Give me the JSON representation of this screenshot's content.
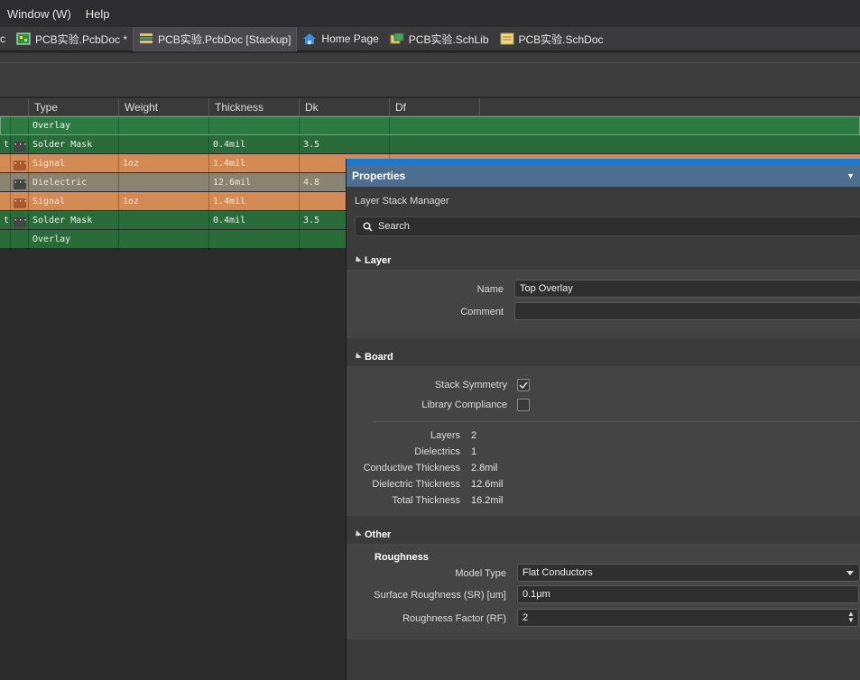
{
  "menu": {
    "window": "Window (W)",
    "help": "Help"
  },
  "tabs": [
    {
      "label": "PCB实验.PcbDoc *",
      "icon": "pcb-doc-icon",
      "active": false
    },
    {
      "label": "PCB实验.PcbDoc [Stackup]",
      "icon": "stackup-icon",
      "active": true
    },
    {
      "label": "Home Page",
      "icon": "home-icon",
      "active": false
    },
    {
      "label": "PCB实验.SchLib",
      "icon": "schlib-icon",
      "active": false
    },
    {
      "label": "PCB实验.SchDoc",
      "icon": "schdoc-icon",
      "active": false
    }
  ],
  "grid": {
    "headers": {
      "type": "Type",
      "weight": "Weight",
      "thickness": "Thickness",
      "dk": "Dk",
      "df": "Df"
    },
    "rows": [
      {
        "prefix": "",
        "type": "Overlay",
        "weight": "",
        "thickness": "",
        "dk": "",
        "style": "green-hl"
      },
      {
        "prefix": "t",
        "type": "Solder Mask",
        "weight": "",
        "thickness": "0.4mil",
        "dk": "3.5",
        "style": "green"
      },
      {
        "prefix": "",
        "type": "Signal",
        "weight": "1oz",
        "thickness": "1.4mil",
        "dk": "",
        "style": "orange"
      },
      {
        "prefix": "",
        "type": "Dielectric",
        "weight": "",
        "thickness": "12.6mil",
        "dk": "4.8",
        "style": "gray"
      },
      {
        "prefix": "",
        "type": "Signal",
        "weight": "1oz",
        "thickness": "1.4mil",
        "dk": "",
        "style": "orange"
      },
      {
        "prefix": "t",
        "type": "Solder Mask",
        "weight": "",
        "thickness": "0.4mil",
        "dk": "3.5",
        "style": "green"
      },
      {
        "prefix": "",
        "type": "Overlay",
        "weight": "",
        "thickness": "",
        "dk": "",
        "style": "green"
      }
    ]
  },
  "properties": {
    "title": "Properties",
    "subtitle": "Layer Stack Manager",
    "search_placeholder": "Search",
    "layer": {
      "header": "Layer",
      "name_label": "Name",
      "name_value": "Top Overlay",
      "comment_label": "Comment",
      "comment_value": ""
    },
    "board": {
      "header": "Board",
      "stack_symmetry_label": "Stack Symmetry",
      "stack_symmetry_checked": true,
      "library_compliance_label": "Library Compliance",
      "library_compliance_checked": false,
      "stats": [
        {
          "label": "Layers",
          "value": "2"
        },
        {
          "label": "Dielectrics",
          "value": "1"
        },
        {
          "label": "Conductive Thickness",
          "value": "2.8mil"
        },
        {
          "label": "Dielectric Thickness",
          "value": "12.6mil"
        },
        {
          "label": "Total Thickness",
          "value": "16.2mil"
        }
      ]
    },
    "other": {
      "header": "Other",
      "roughness_header": "Roughness",
      "model_type_label": "Model Type",
      "model_type_value": "Flat Conductors",
      "sr_label": "Surface Roughness (SR) [um]",
      "sr_value": "0.1μm",
      "rf_label": "Roughness Factor (RF)",
      "rf_value": "2"
    }
  },
  "colors": {
    "accent": "#1e78d0",
    "title_bar": "#4e6e8f",
    "green": "#2a6b3a",
    "orange": "#d48a55",
    "dielectric": "#8a8372"
  }
}
